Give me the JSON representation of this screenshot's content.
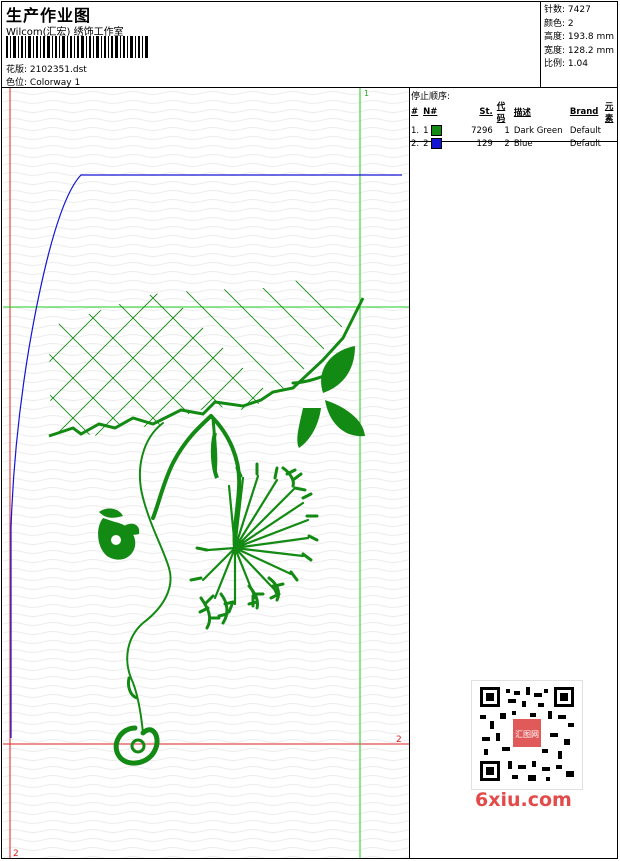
{
  "header": {
    "title": "生产作业图",
    "studio": "Wilcom(汇宏) 绣饰工作室",
    "design_label": "花版:",
    "design_value": "2102351.dst",
    "colorway_label": "色位:",
    "colorway_value": "Colorway 1"
  },
  "stats": {
    "stitches": "针数: 7427",
    "colors": "颜色: 2",
    "height": "高度: 193.8 mm",
    "width": "宽度: 128.2 mm",
    "scale": "比例: 1.04"
  },
  "stop_sequence": {
    "title": "停止顺序:",
    "headers": [
      "#",
      "N#",
      "St.",
      "代码",
      "描述",
      "Brand",
      "元素"
    ],
    "rows": [
      {
        "index": "1.",
        "needle": "1",
        "stitches": "7296",
        "code": "1",
        "description": "Dark Green",
        "brand": "Default",
        "color": "#138a13"
      },
      {
        "index": "2.",
        "needle": "2",
        "stitches": "129",
        "code": "2",
        "description": "Blue",
        "brand": "Default",
        "color": "#1414d4"
      }
    ]
  },
  "guides": {
    "label_top": "1",
    "label_right": "2",
    "label_bottom": "2"
  },
  "watermark": {
    "text": "6xiu.com",
    "stamp_text": "汇图网"
  },
  "colors": {
    "thread_green": "#138a13",
    "thread_blue": "#1414d4",
    "guide_green": "#22cc22",
    "guide_red": "#dd2222"
  }
}
